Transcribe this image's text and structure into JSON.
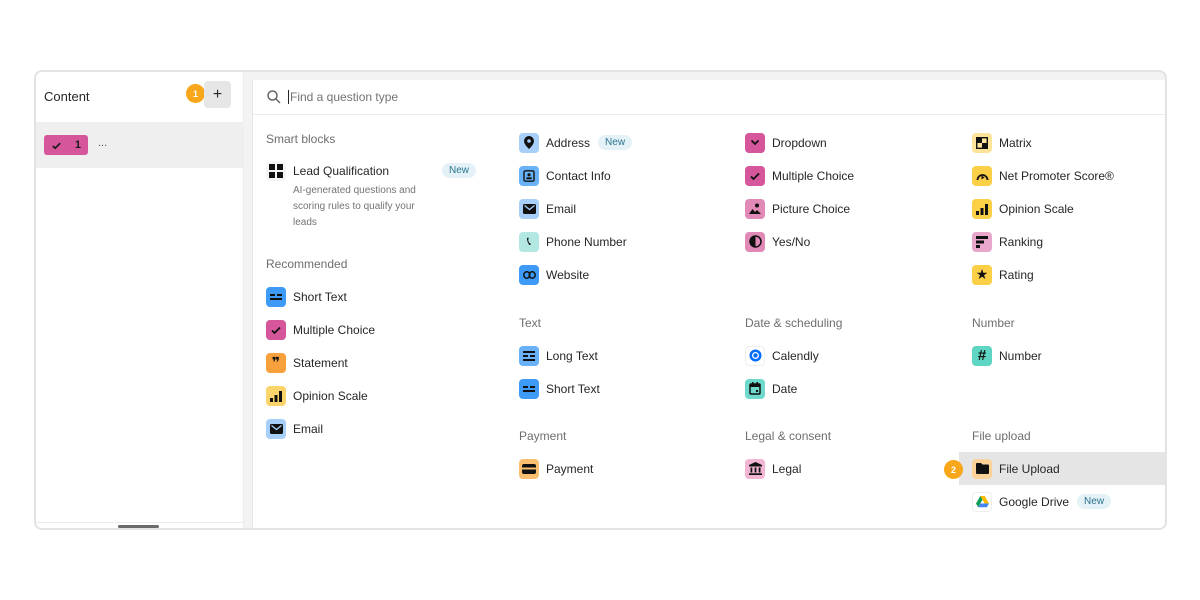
{
  "sidebar": {
    "title": "Content",
    "add_label": "+",
    "step_badge": "1",
    "item": {
      "number": "1",
      "icon": "checkmark-icon",
      "label": "...",
      "color": "#d5569a"
    }
  },
  "search": {
    "placeholder": "Find a question type",
    "value": ""
  },
  "sections": {
    "smart_blocks": {
      "title": "Smart blocks",
      "items": [
        {
          "label": "Lead Qualification",
          "badge": "New",
          "description": "AI-generated questions and scoring rules to qualify your leads",
          "icon": "grid-icon"
        }
      ]
    },
    "recommended": {
      "title": "Recommended",
      "items": [
        {
          "label": "Short Text",
          "icon": "short-text-icon",
          "color": "#3d9bf7"
        },
        {
          "label": "Multiple Choice",
          "icon": "checkmark-icon",
          "color": "#d5569a"
        },
        {
          "label": "Statement",
          "icon": "quote-icon",
          "color": "#f8a03c"
        },
        {
          "label": "Opinion Scale",
          "icon": "bar-chart-icon",
          "color": "#fbd46b"
        },
        {
          "label": "Email",
          "icon": "envelope-icon",
          "color": "#a7cff9"
        }
      ]
    },
    "contact": {
      "items": [
        {
          "label": "Address",
          "badge": "New",
          "icon": "location-pin-icon",
          "color": "#a7cff9"
        },
        {
          "label": "Contact Info",
          "icon": "contact-card-icon",
          "color": "#6ab2f7"
        },
        {
          "label": "Email",
          "icon": "envelope-icon",
          "color": "#a7cff9"
        },
        {
          "label": "Phone Number",
          "icon": "phone-icon",
          "color": "#b3e8e2"
        },
        {
          "label": "Website",
          "icon": "link-icon",
          "color": "#3d9bf7"
        }
      ]
    },
    "text": {
      "title": "Text",
      "items": [
        {
          "label": "Long Text",
          "icon": "long-text-icon",
          "color": "#6ab2f7"
        },
        {
          "label": "Short Text",
          "icon": "short-text-icon",
          "color": "#3d9bf7"
        }
      ]
    },
    "payment": {
      "title": "Payment",
      "items": [
        {
          "label": "Payment",
          "icon": "credit-card-icon",
          "color": "#fbbf6f"
        }
      ]
    },
    "choice": {
      "items": [
        {
          "label": "Dropdown",
          "icon": "chevron-down-icon",
          "color": "#d5569a"
        },
        {
          "label": "Multiple Choice",
          "icon": "checkmark-icon",
          "color": "#d5569a"
        },
        {
          "label": "Picture Choice",
          "icon": "picture-icon",
          "color": "#e18ab8"
        },
        {
          "label": "Yes/No",
          "icon": "half-circle-icon",
          "color": "#e18ab8"
        }
      ]
    },
    "date_scheduling": {
      "title": "Date & scheduling",
      "items": [
        {
          "label": "Calendly",
          "icon": "calendly-icon",
          "color": "#ffffff"
        },
        {
          "label": "Date",
          "icon": "calendar-icon",
          "color": "#6fd9cb"
        }
      ]
    },
    "legal": {
      "title": "Legal & consent",
      "items": [
        {
          "label": "Legal",
          "icon": "bank-icon",
          "color": "#f2b5d4"
        }
      ]
    },
    "rating": {
      "items": [
        {
          "label": "Matrix",
          "icon": "matrix-icon",
          "color": "#fde49a"
        },
        {
          "label": "Net Promoter Score®",
          "icon": "gauge-icon",
          "color": "#fbd046"
        },
        {
          "label": "Opinion Scale",
          "icon": "bar-chart-icon",
          "color": "#fbd046"
        },
        {
          "label": "Ranking",
          "icon": "ranking-icon",
          "color": "#e8a6cb"
        },
        {
          "label": "Rating",
          "icon": "star-icon",
          "color": "#fbd046"
        }
      ]
    },
    "number": {
      "title": "Number",
      "items": [
        {
          "label": "Number",
          "icon": "hash-icon",
          "color": "#5fd6c3"
        }
      ]
    },
    "file_upload": {
      "title": "File upload",
      "step_badge": "2",
      "items": [
        {
          "label": "File Upload",
          "icon": "folder-icon",
          "color": "#fbd29a",
          "highlighted": true
        },
        {
          "label": "Google Drive",
          "badge": "New",
          "icon": "google-drive-icon",
          "color": "#ffffff"
        }
      ]
    }
  }
}
